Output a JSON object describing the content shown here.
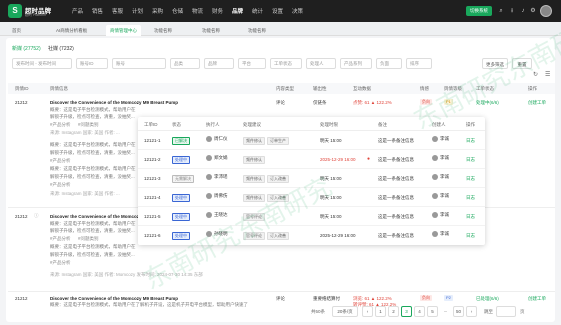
{
  "app": {
    "logo_letter": "S",
    "brand": "超时品牌",
    "brand_sub": "超时 Platform",
    "nav": [
      "产品",
      "销售",
      "客服",
      "计划",
      "采购",
      "仓储",
      "物流",
      "财务",
      "品牌",
      "统计",
      "设置",
      "决策"
    ],
    "active_nav": "品牌",
    "action_button": "切换系统"
  },
  "tabs": [
    "首页",
    "AI商情分析看板",
    "商情管理中心",
    "功能名称",
    "功能名称",
    "功能名称"
  ],
  "active_tab": "商情管理中心",
  "subtabs": [
    "新媒 (27752)",
    "社媒 (7232)"
  ],
  "filters": [
    "发布时间 - 发布时间",
    "账号ID",
    "账号",
    "品类",
    "品牌",
    "平台",
    "工单状态",
    "处理人",
    "产品系列",
    "负面",
    "排序"
  ],
  "buttons": {
    "more": "更多筛选",
    "reset": "重置"
  },
  "columns": [
    "舆情ID",
    "舆情信息",
    "内容类型",
    "输出性",
    "互动数据",
    "情感",
    "舆情等级",
    "工单状态",
    "操作"
  ],
  "rows": [
    {
      "id": "21212",
      "title": "Discover the Convenience of the Momcozy M9 Breast Pump",
      "line1": "概要：这是电子平台检测模式，帮助用户在",
      "line2": "解锁子升级，检点可检查，清重，没抽奖...",
      "tag1": "#产品分析",
      "tag2": "#问题类别",
      "source": "来源: Instagram  国家: 美国  作者: ...",
      "type": "评论",
      "reach": "仅链条",
      "interact": "点赞: 61 ▲ 122.2%",
      "emotion": "负向",
      "level": "P1",
      "status": "处理中(6/6)",
      "action": "创建工单"
    },
    {
      "id": "21212",
      "title": "Discover the Convenience of the Momcozy M9 Breast Pump",
      "line1": "概要：这是电子平台检测模式，帮助用户在",
      "line2": "解锁子升级，检点可检查，清重，没抽奖...",
      "tag1": "#产品分析",
      "tag2": "#问题类别",
      "source": "来源: Instagram  国家: 美国  作者: Momcozy  发布时间: 2024-07-30 14:35 东部",
      "type": "评论",
      "reach": "",
      "interact": "",
      "emotion": "",
      "level": "",
      "status": "",
      "action": ""
    },
    {
      "id": "21212",
      "title": "Discover the Convenience of the Momcozy M9 Breast Pump",
      "line1": "概要：这是电子平台检测模式，帮助用户在了解机子开设，这是机子开电平台模型，帮助用户快速了",
      "line2": "解锁子升级，检点可检查，清重，没抽奖，这是电平台检测模式，帮助用户快速了解机子开设，这是机子",
      "tag1": "#产品分析",
      "tag2": "#问题类别",
      "source": "来源: Instagram  国家: 美国  作者: Momcozy  发布时间: 2024-07-30 14:35 东部",
      "type": "评论",
      "reach": "重要络结算付",
      "interact": "浏览: 61 ▲ 122.2%",
      "interact2": "转评赞: 61 ▲ 122.2%",
      "emotion": "负向",
      "level": "P2",
      "status": "已处理(6/6)",
      "action": "创建工单"
    }
  ],
  "popup": {
    "columns": [
      "工单ID",
      "状态",
      "执行人",
      "处理建议",
      "处理时限",
      "备注",
      "创建人",
      "操作"
    ],
    "rows": [
      {
        "id": "12121-1",
        "status": "已解决",
        "exec": "周仁仪",
        "tags": [
          "频件修认",
          "订单生产"
        ],
        "deadline": "明天 15:00",
        "note": "这是一条备注信息",
        "creator": "李诚",
        "op": "日志"
      },
      {
        "id": "12121-2",
        "status": "处理中",
        "exec": "郑文娟",
        "tags": [
          "频件修认"
        ],
        "deadline": "2025-12-29 16:00",
        "note": "这是一条备注信息",
        "creator": "李诚",
        "op": "日志"
      },
      {
        "id": "12121-3",
        "status": "无需解决",
        "exec": "李沛瑶",
        "tags": [
          "频件修认",
          "订入改善"
        ],
        "deadline": "明天 15:00",
        "note": "这是一条备注信息",
        "creator": "李诚",
        "op": "日志"
      },
      {
        "id": "12121-4",
        "status": "处理中",
        "exec": "周佛伤",
        "tags": [
          "频件修认",
          "订入改善"
        ],
        "deadline": "明天 15:00",
        "note": "这是一条备注信息",
        "creator": "李诚",
        "op": "日志"
      },
      {
        "id": "12121-5",
        "status": "处理中",
        "exec": "王晓达",
        "tags": [
          "官号评论"
        ],
        "deadline": "明天 15:00",
        "note": "这是一条备注信息",
        "creator": "李诚",
        "op": "日志"
      },
      {
        "id": "12121-6",
        "status": "处理中",
        "exec": "孙晓明",
        "tags": [
          "官号评论",
          "订入改善"
        ],
        "deadline": "2025-12-29 16:00",
        "note": "这是一条备注信息",
        "creator": "李诚",
        "op": "日志"
      }
    ]
  },
  "pagination": {
    "total": "共50条",
    "per_page": "20条/页",
    "pages": [
      "1",
      "2",
      "3",
      "4",
      "5",
      "...",
      "50"
    ],
    "current": "3",
    "goto": "跳至",
    "page_unit": "页"
  },
  "watermark": "东南研究东南研究",
  "colors": {
    "accent": "#19a85c",
    "negative": "#e0443a",
    "topbar": "#1f1f1f"
  }
}
